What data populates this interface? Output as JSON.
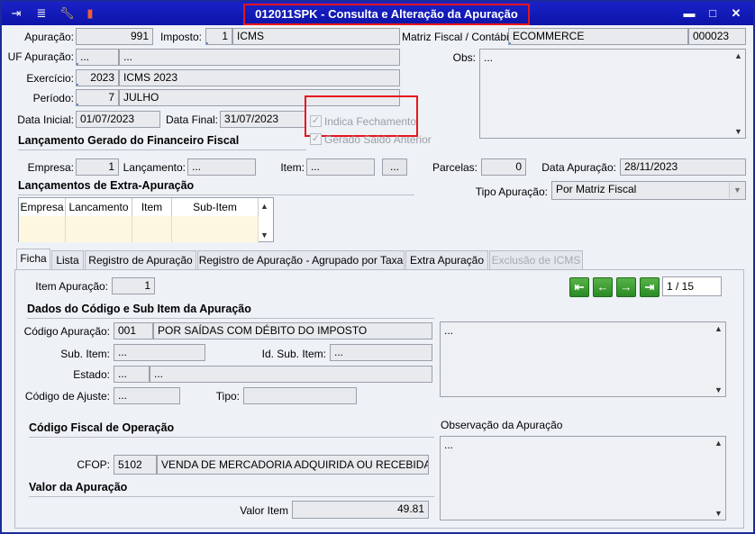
{
  "window": {
    "title": "012011SPK - Consulta e Alteração da Apuração",
    "toolbar_icons": [
      "exit-icon",
      "list-icon",
      "wrench-icon",
      "book-icon"
    ],
    "controls": [
      "minimize",
      "maximize",
      "close"
    ]
  },
  "header": {
    "apuracao_label": "Apuração:",
    "apuracao_value": "991",
    "imposto_label": "Imposto:",
    "imposto_code": "1",
    "imposto_name": "ICMS",
    "matriz_label": "Matriz Fiscal / Contábil:",
    "matriz_name": "ECOMMERCE",
    "matriz_code": "000023",
    "uf_label": "UF Apuração:",
    "uf_code": "...",
    "uf_name": "...",
    "obs_label": "Obs:",
    "obs_value": "...",
    "exercicio_label": "Exercício:",
    "exercicio_code": "2023",
    "exercicio_name": "ICMS 2023",
    "periodo_label": "Período:",
    "periodo_code": "7",
    "periodo_name": "JULHO",
    "data_inicial_label": "Data Inicial:",
    "data_inicial": "01/07/2023",
    "data_final_label": "Data Final:",
    "data_final": "31/07/2023",
    "indica_fechamento": "Indica Fechamento",
    "gerado_saldo": "Gerado Saldo Anterior"
  },
  "financeiro": {
    "section_title": "Lançamento Gerado do Financeiro Fiscal",
    "empresa_label": "Empresa:",
    "empresa_value": "1",
    "lancamento_label": "Lançamento:",
    "lancamento_value": "...",
    "item_label": "Item:",
    "item_value": "...",
    "lookup_button": "...",
    "parcelas_label": "Parcelas:",
    "parcelas_value": "0",
    "data_apuracao_label": "Data Apuração:",
    "data_apuracao_value": "28/11/2023",
    "tipo_apuracao_label": "Tipo Apuração:",
    "tipo_apuracao_value": "Por Matriz Fiscal"
  },
  "extra": {
    "section_title": "Lançamentos de Extra-Apuração",
    "columns": [
      "Empresa",
      "Lancamento",
      "Item",
      "Sub-Item"
    ]
  },
  "tabs": [
    "Ficha",
    "Lista",
    "Registro de Apuração",
    "Registro de Apuração - Agrupado por Taxa",
    "Extra Apuração",
    "Exclusão de ICMS"
  ],
  "ficha": {
    "item_apuracao_label": "Item Apuração:",
    "item_apuracao_value": "1",
    "page_indicator": "1 / 15",
    "dados_title": "Dados do Código e Sub Item da Apuração",
    "codigo_label": "Código Apuração:",
    "codigo_value": "001",
    "codigo_desc": "POR SAÍDAS COM DÉBITO DO IMPOSTO",
    "sub_item_label": "Sub. Item:",
    "sub_item_value": "...",
    "id_sub_item_label": "Id. Sub. Item:",
    "id_sub_item_value": "...",
    "estado_label": "Estado:",
    "estado_code": "...",
    "estado_name": "...",
    "codigo_ajuste_label": "Código de Ajuste:",
    "codigo_ajuste_value": "...",
    "tipo_label": "Tipo:",
    "tipo_value": "",
    "memo1_value": "...",
    "cfop_title": "Código Fiscal de Operação",
    "obs_apuracao_label": "Observação da Apuração",
    "obs_apuracao_value": "...",
    "cfop_label": "CFOP:",
    "cfop_code": "5102",
    "cfop_desc": "VENDA DE MERCADORIA ADQUIRIDA OU RECEBIDA DE TEI",
    "valor_title": "Valor da Apuração",
    "valor_item_label": "Valor Item",
    "valor_item_value": "49.81"
  }
}
